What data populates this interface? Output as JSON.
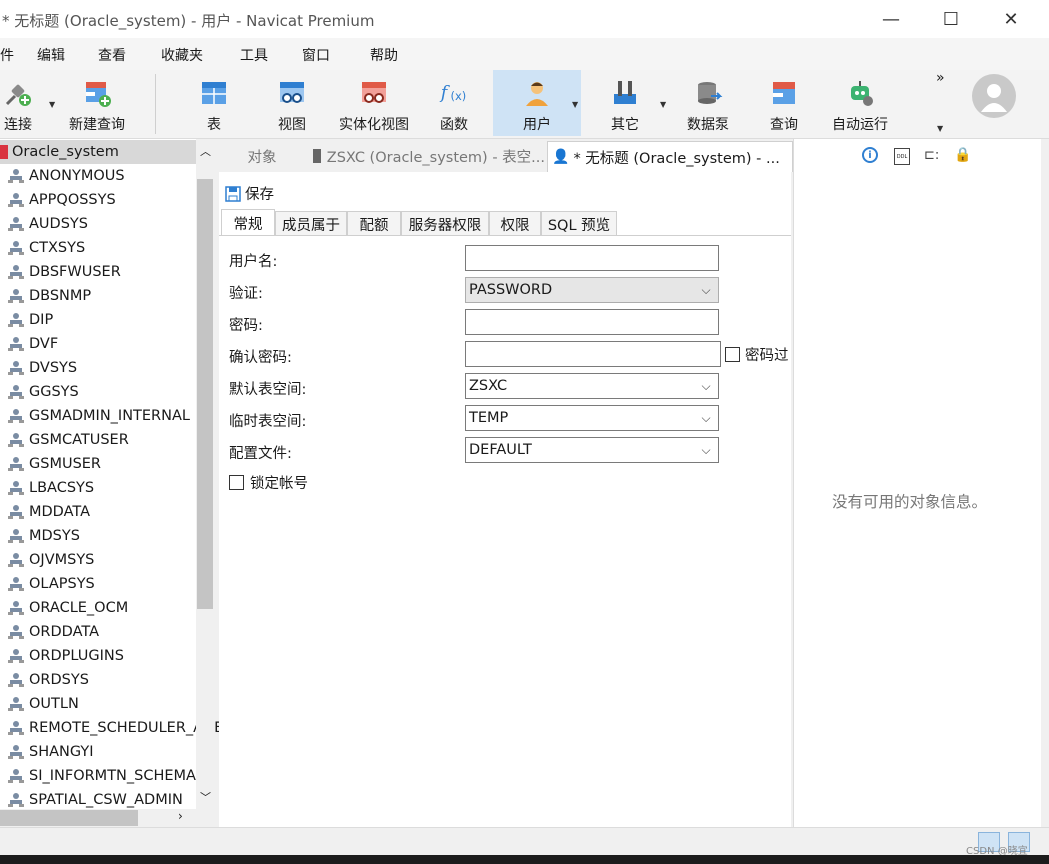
{
  "window": {
    "title": "* 无标题 (Oracle_system) - 用户 - Navicat Premium"
  },
  "menu": [
    "件",
    "编辑",
    "查看",
    "收藏夹",
    "工具",
    "窗口",
    "帮助"
  ],
  "toolbar": {
    "buttons": [
      {
        "label": "连接",
        "icon": "plug-icon"
      },
      {
        "label": "新建查询",
        "icon": "new-query-icon"
      },
      {
        "label": "表",
        "icon": "table-icon"
      },
      {
        "label": "视图",
        "icon": "view-icon"
      },
      {
        "label": "实体化视图",
        "icon": "materialized-view-icon"
      },
      {
        "label": "函数",
        "icon": "function-icon"
      },
      {
        "label": "用户",
        "icon": "user-icon"
      },
      {
        "label": "其它",
        "icon": "tools-icon"
      },
      {
        "label": "数据泵",
        "icon": "data-pump-icon"
      },
      {
        "label": "查询",
        "icon": "query-icon"
      },
      {
        "label": "自动运行",
        "icon": "robot-icon"
      }
    ],
    "more": "»"
  },
  "tree": {
    "root": "Oracle_system",
    "items": [
      "ANONYMOUS",
      "APPQOSSYS",
      "AUDSYS",
      "CTXSYS",
      "DBSFWUSER",
      "DBSNMP",
      "DIP",
      "DVF",
      "DVSYS",
      "GGSYS",
      "GSMADMIN_INTERNAL",
      "GSMCATUSER",
      "GSMUSER",
      "LBACSYS",
      "MDDATA",
      "MDSYS",
      "OJVMSYS",
      "OLAPSYS",
      "ORACLE_OCM",
      "ORDDATA",
      "ORDPLUGINS",
      "ORDSYS",
      "OUTLN",
      "REMOTE_SCHEDULER_AGENT",
      "SHANGYI",
      "SI_INFORMTN_SCHEMA",
      "SPATIAL_CSW_ADMIN"
    ]
  },
  "tabs": {
    "objects": "对象",
    "tab2": "ZSXC (Oracle_system) - 表空...",
    "tab3": "* 无标题 (Oracle_system) - ..."
  },
  "editor": {
    "save": "保存",
    "subtabs": [
      "常规",
      "成员属于",
      "配额",
      "服务器权限",
      "权限",
      "SQL 预览"
    ],
    "form": {
      "username_label": "用户名:",
      "username_value": "",
      "auth_label": "验证:",
      "auth_value": "PASSWORD",
      "password_label": "密码:",
      "password_value": "",
      "confirm_label": "确认密码:",
      "confirm_value": "",
      "expire_label": "密码过",
      "default_ts_label": "默认表空间:",
      "default_ts_value": "ZSXC",
      "temp_ts_label": "临时表空间:",
      "temp_ts_value": "TEMP",
      "profile_label": "配置文件:",
      "profile_value": "DEFAULT",
      "lock_label": "锁定帐号"
    }
  },
  "right_panel": {
    "empty_message": "没有可用的对象信息。",
    "icons": [
      "info-icon",
      "ddl-icon",
      "dependency-icon",
      "lock-icon"
    ],
    "ddl_text": "DDL"
  },
  "watermark": "CSDN @晓宜"
}
